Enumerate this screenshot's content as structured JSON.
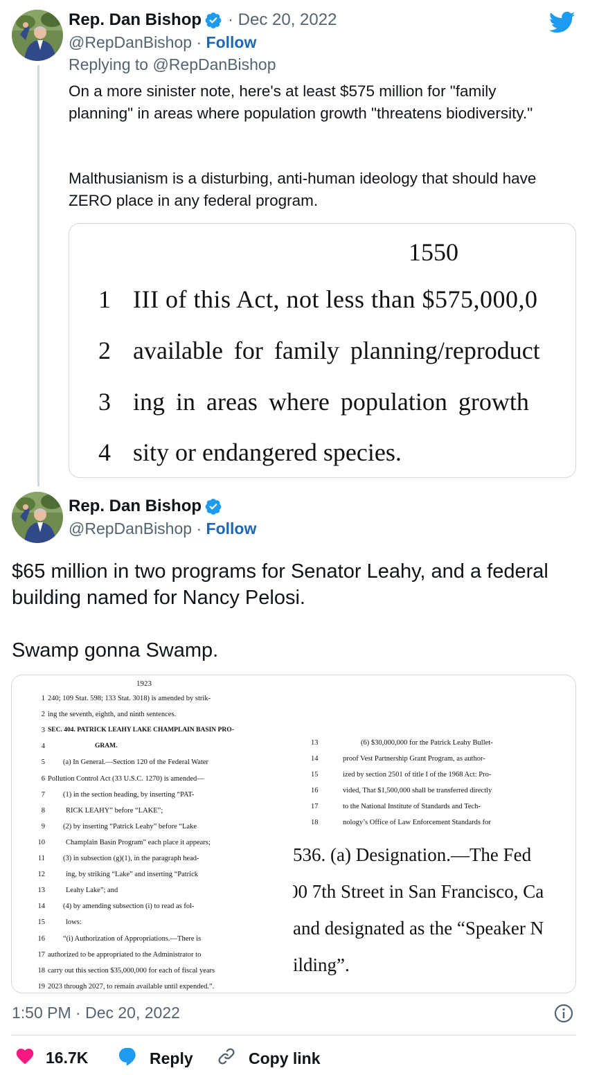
{
  "first_tweet": {
    "author_name": "Rep. Dan Bishop",
    "date": "· Dec 20, 2022",
    "handle": "@RepDanBishop",
    "separator": "·",
    "follow_label": "Follow",
    "replying_to": "Replying to @RepDanBishop",
    "text_para1": "On a more sinister note, here's at least $575 million for \"family planning\" in areas where population growth \"threatens biodiversity.\"",
    "text_para2": "Malthusianism is a disturbing, anti-human ideology that should have ZERO place in any federal program.",
    "image": {
      "page_number": "1550",
      "lines": [
        {
          "num": "1",
          "text": "III of this Act, not less than $575,000,0"
        },
        {
          "num": "2",
          "text": "available for family planning/reproduct"
        },
        {
          "num": "3",
          "text": "ing in areas where population growth"
        },
        {
          "num": "4",
          "text": "sity or endangered species."
        }
      ]
    }
  },
  "main_tweet": {
    "author_name": "Rep. Dan Bishop",
    "handle": "@RepDanBishop",
    "separator": "·",
    "follow_label": "Follow",
    "text_para1": "$65 million in two programs for Senator Leahy, and a federal building named for Nancy Pelosi.",
    "text_para2": "Swamp gonna Swamp.",
    "image": {
      "left_page": {
        "page_number": "1923",
        "lines": [
          {
            "num": "1",
            "text": "240; 109 Stat. 598; 133 Stat. 3018) is amended by strik-"
          },
          {
            "num": "2",
            "text": "ing the seventh, eighth, and ninth sentences."
          },
          {
            "num": "3",
            "text": "SEC. 404. PATRICK LEAHY LAKE CHAMPLAIN BASIN PRO-"
          },
          {
            "num": "4",
            "text": "GRAM."
          },
          {
            "num": "5",
            "text": "(a) In General.—Section 120 of the Federal Water"
          },
          {
            "num": "6",
            "text": "Pollution Control Act (33 U.S.C. 1270) is amended—"
          },
          {
            "num": "7",
            "text": "(1) in the section heading, by inserting “PAT-"
          },
          {
            "num": "8",
            "text": "RICK LEAHY” before “LAKE”;"
          },
          {
            "num": "9",
            "text": "(2) by inserting “Patrick Leahy” before “Lake"
          },
          {
            "num": "10",
            "text": "Champlain Basin Program” each place it appears;"
          },
          {
            "num": "11",
            "text": "(3) in subsection (g)(1), in the paragraph head-"
          },
          {
            "num": "12",
            "text": "ing, by striking “Lake” and inserting “Patrick"
          },
          {
            "num": "13",
            "text": "Leahy Lake”; and"
          },
          {
            "num": "14",
            "text": "(4) by amending subsection (i) to read as fol-"
          },
          {
            "num": "15",
            "text": "lows:"
          },
          {
            "num": "16",
            "text": "“(i) Authorization of Appropriations.—There is"
          },
          {
            "num": "17",
            "text": "authorized to be appropriated to the Administrator to"
          },
          {
            "num": "18",
            "text": "carry out this section $35,000,000 for each of fiscal years"
          },
          {
            "num": "19",
            "text": "2023 through 2027, to remain available until expended.”."
          }
        ]
      },
      "right_top": {
        "lines": [
          {
            "num": "13",
            "text": "(6) $30,000,000 for the Patrick Leahy Bullet-"
          },
          {
            "num": "14",
            "text": "proof Vest Partnership Grant Program, as author-"
          },
          {
            "num": "15",
            "text": "ized by section 2501 of title I of the 1968 Act: Pro-"
          },
          {
            "num": "16",
            "text": "vided, That $1,500,000 shall be transferred directly"
          },
          {
            "num": "17",
            "text": "to the National Institute of Standards and Tech-"
          },
          {
            "num": "18",
            "text": "nology’s Office of Law Enforcement Standards for"
          }
        ]
      },
      "right_bottom": {
        "lines": [
          "536. (a) Designation.—The Fed",
          "00 7th Street in San Francisco, Ca",
          "and designated as the “Speaker N",
          "ilding”."
        ]
      }
    },
    "timestamp": "1:50 PM · Dec 20, 2022",
    "actions": {
      "likes": "16.7K",
      "reply_label": "Reply",
      "copy_link_label": "Copy link"
    }
  },
  "colors": {
    "verified_blue": "#1d9bf0",
    "twitter_blue": "#1d9bf0",
    "follow_blue": "#1d68b5",
    "like_red": "#f91880",
    "gray_text": "#536471"
  },
  "icons": [
    "twitter-bird-icon",
    "verified-badge-icon",
    "info-icon",
    "heart-icon",
    "reply-bubble-icon",
    "link-icon"
  ]
}
